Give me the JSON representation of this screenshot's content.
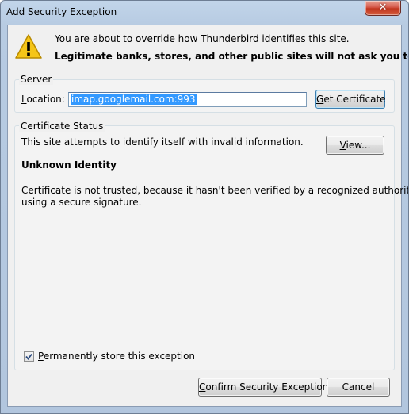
{
  "window": {
    "title": "Add Security Exception",
    "close_glyph": "✕"
  },
  "intro": {
    "line1": "You are about to override how Thunderbird identifies this site.",
    "line2": "Legitimate banks, stores, and other public sites will not ask you to do this.",
    "icon": "warning-icon"
  },
  "server": {
    "group_label": "Server",
    "location_label": "Location:",
    "location_value": "imap.googlemail.com:993",
    "get_certificate_label": "Get Certificate"
  },
  "certificate_status": {
    "group_label": "Certificate Status",
    "status_line": "This site attempts to identify itself with invalid information.",
    "view_label": "View...",
    "identity_heading": "Unknown Identity",
    "description_line1": "Certificate is not trusted, because it hasn't been verified by a recognized authority",
    "description_line2": "using a secure signature."
  },
  "store": {
    "label": "Permanently store this exception",
    "checked": true
  },
  "buttons": {
    "confirm": "Confirm Security Exception",
    "cancel": "Cancel"
  },
  "colors": {
    "title_bar": "#b9cde4",
    "close_button": "#c9432c",
    "selection": "#3399ff",
    "warning_yellow": "#f5c518"
  }
}
